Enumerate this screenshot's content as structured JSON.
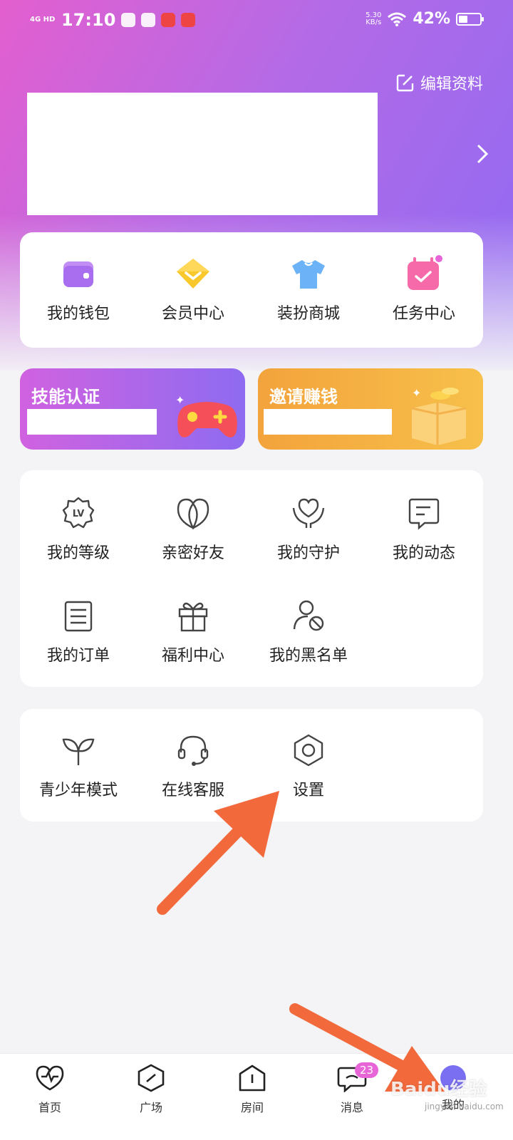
{
  "status_bar": {
    "network": "4G HD",
    "time": "17:10",
    "speed_value": "5.30",
    "speed_unit": "KB/s",
    "battery": "42%"
  },
  "header": {
    "edit_profile_label": "编辑资料"
  },
  "quick_actions": [
    {
      "label": "我的钱包",
      "icon": "wallet-icon"
    },
    {
      "label": "会员中心",
      "icon": "diamond-icon"
    },
    {
      "label": "装扮商城",
      "icon": "tshirt-icon"
    },
    {
      "label": "任务中心",
      "icon": "calendar-check-icon"
    }
  ],
  "promos": {
    "skill": {
      "title": "技能认证",
      "icon": "gamepad-icon"
    },
    "invite": {
      "title": "邀请赚钱",
      "icon": "treasure-box-icon"
    }
  },
  "features": [
    {
      "label": "我的等级",
      "icon": "level-badge-icon"
    },
    {
      "label": "亲密好友",
      "icon": "intimate-friends-icon"
    },
    {
      "label": "我的守护",
      "icon": "heart-guard-icon"
    },
    {
      "label": "我的动态",
      "icon": "post-icon"
    },
    {
      "label": "我的订单",
      "icon": "order-list-icon"
    },
    {
      "label": "福利中心",
      "icon": "gift-icon"
    },
    {
      "label": "我的黑名单",
      "icon": "blocked-user-icon"
    }
  ],
  "tools": [
    {
      "label": "青少年模式",
      "icon": "sprout-icon"
    },
    {
      "label": "在线客服",
      "icon": "headset-icon"
    },
    {
      "label": "设置",
      "icon": "settings-hexagon-icon"
    }
  ],
  "bottom_nav": [
    {
      "label": "首页",
      "icon": "heart-pulse-icon"
    },
    {
      "label": "广场",
      "icon": "compass-hexagon-icon"
    },
    {
      "label": "房间",
      "icon": "room-icon"
    },
    {
      "label": "消息",
      "icon": "message-icon",
      "badge": "23"
    },
    {
      "label": "我的",
      "icon": "profile-avatar-icon"
    }
  ],
  "watermark": {
    "text": "Baidu经验",
    "url_text": "jingyan.baidu.com"
  },
  "colors": {
    "accent": "#8f6af3",
    "brand_pink": "#e35fcf",
    "arrow": "#f2693c"
  }
}
